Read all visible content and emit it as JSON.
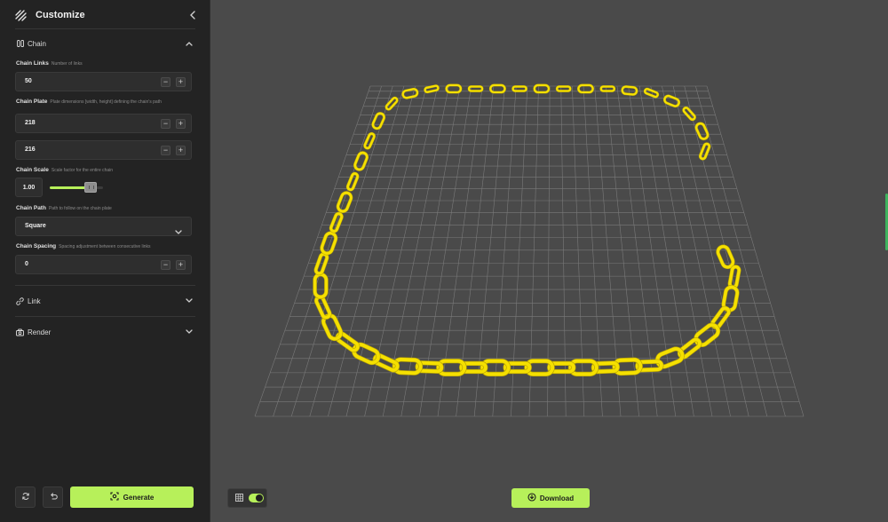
{
  "sidebar": {
    "title": "Customize",
    "sections": {
      "chain": {
        "label": "Chain",
        "fields": {
          "links": {
            "label": "Chain Links",
            "hint": "Number of links",
            "value": "50"
          },
          "plate": {
            "label": "Chain Plate",
            "hint": "Plate dimensions [width, height] defining the chain's path",
            "width": "218",
            "height": "216"
          },
          "scale": {
            "label": "Chain Scale",
            "hint": "Scale factor for the entire chain",
            "value": "1.00",
            "slider_level_percent": 85
          },
          "path": {
            "label": "Chain Path",
            "hint": "Path to follow on the chain plate",
            "value": "Square"
          },
          "spacing": {
            "label": "Chain Spacing",
            "hint": "Spacing adjustment between consecutive links",
            "value": "0"
          }
        }
      },
      "link": {
        "label": "Link"
      },
      "render": {
        "label": "Render"
      }
    },
    "actions": {
      "generate_label": "Generate"
    }
  },
  "viewport": {
    "grid_toggle_on": true,
    "download_label": "Download"
  },
  "colors": {
    "accent": "#b7f05a",
    "chain": "#f5e000",
    "panel": "#232323",
    "viewport": "#4a4a4a"
  }
}
